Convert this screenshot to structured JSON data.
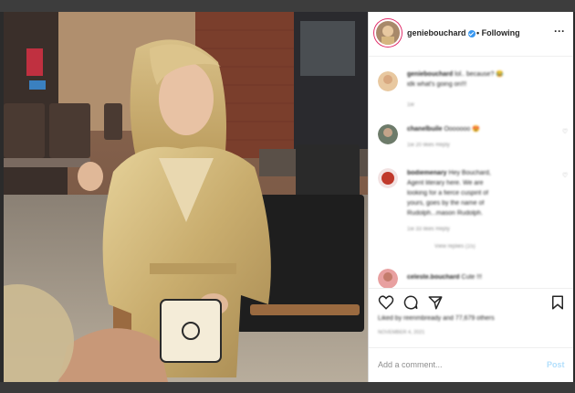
{
  "header": {
    "username": "geniebouchard",
    "separator": "•",
    "follow_status": "Following",
    "more_icon": "more-icon"
  },
  "comments": [
    {
      "username": "geniebouchard",
      "text": "lol.. because? 😂",
      "text2": "idk what's going on!!!",
      "meta": "1w",
      "avatar_color": "#e8c8a0"
    },
    {
      "username": "chanelbuile",
      "text": "Ooooooo 😍",
      "meta": "1w   20 likes   Reply",
      "avatar_color": "#6d7b6a"
    },
    {
      "username": "bodiemenary",
      "text": "Hey Bouchard,",
      "text2": "Agent literary here. We are",
      "text3": "looking for a fierce cuspirit of",
      "text4": "yours, goes by the name of",
      "text5": "Rudolph...mason Rudolph.",
      "meta": "1w   33 likes   Reply",
      "replies": "View replies (15)",
      "avatar_color": "#c0392b"
    },
    {
      "username": "celeste.bouchard",
      "text": "Cute !!!",
      "avatar_color": "#e8a0a0"
    }
  ],
  "actions": {
    "like_icon": "heart-icon",
    "comment_icon": "comment-icon",
    "share_icon": "share-icon",
    "save_icon": "bookmark-icon"
  },
  "likes_text": "Liked by reenmbready and 77,679 others",
  "date": "NOVEMBER 4, 2021",
  "add_comment": {
    "placeholder": "Add a comment...",
    "post_label": "Post"
  },
  "colors": {
    "accent": "#3897f0",
    "post_disabled": "#b2dffc",
    "ring": "#e1306c"
  }
}
